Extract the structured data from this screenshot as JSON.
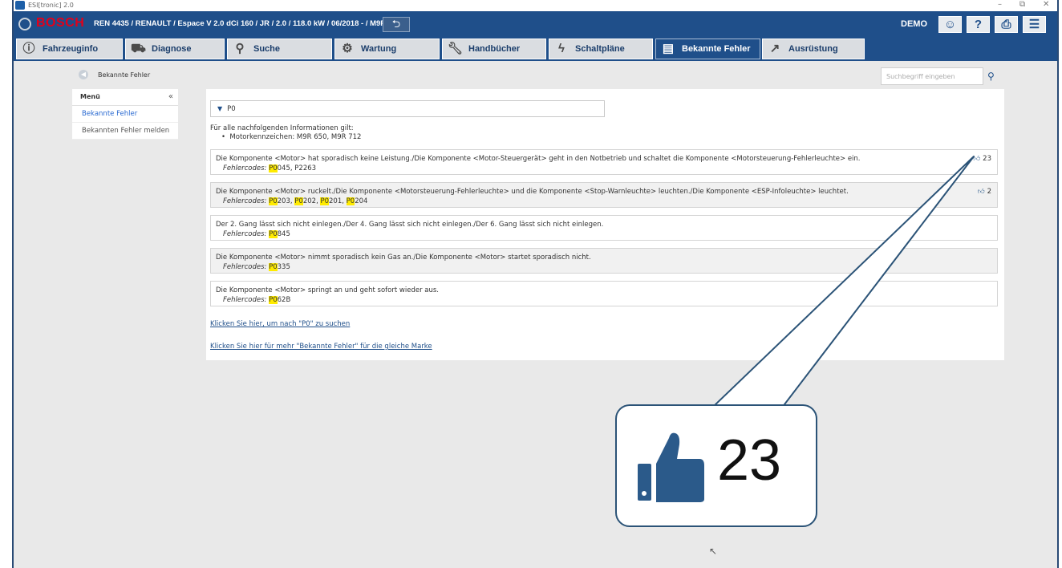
{
  "window": {
    "title": "ESI[tronic] 2.0",
    "controls": [
      "–",
      "⧉",
      "✕"
    ]
  },
  "header": {
    "brand": "BOSCH",
    "vehicle": "REN 4435 / RENAULT / Espace V 2.0 dCi 160 / JR / 2.0 / 118.0 kW / 06/2018 - / M9R...",
    "mode": "DEMO"
  },
  "tabs": [
    {
      "label": "Fahrzeuginfo",
      "icon": "info-icon"
    },
    {
      "label": "Diagnose",
      "icon": "car-icon"
    },
    {
      "label": "Suche",
      "icon": "search-icon"
    },
    {
      "label": "Wartung",
      "icon": "gears-icon"
    },
    {
      "label": "Handbücher",
      "icon": "wrench-icon"
    },
    {
      "label": "Schaltpläne",
      "icon": "lightning-icon"
    },
    {
      "label": "Bekannte Fehler",
      "icon": "book-icon",
      "active": true
    },
    {
      "label": "Ausrüstung",
      "icon": "external-link-icon"
    }
  ],
  "breadcrumb": {
    "label": "Bekannte Fehler"
  },
  "search": {
    "placeholder": "Suchbegriff eingeben"
  },
  "sidebar": {
    "title": "Menü",
    "items": [
      {
        "label": "Bekannte Fehler",
        "active": true
      },
      {
        "label": "Bekannten Fehler melden"
      }
    ]
  },
  "filter": {
    "value": "P0"
  },
  "intro": {
    "text": "Für alle nachfolgenden Informationen gilt:",
    "bullet": "Motorkennzeichen: M9R 650, M9R 712"
  },
  "codes_label": "Fehlercodes:",
  "faults": [
    {
      "description": "Die Komponente <Motor> hat sporadisch keine Leistung./Die Komponente <Motor-Steuergerät> geht in den Notbetrieb und schaltet die Komponente <Motorsteuerung-Fehlerleuchte> ein.",
      "codes": [
        {
          "hl": "P0",
          "rest": "045"
        },
        {
          "plain": "P2263"
        }
      ],
      "likes": "23"
    },
    {
      "description": "Die Komponente <Motor> ruckelt./Die Komponente <Motorsteuerung-Fehlerleuchte> und die Komponente <Stop-Warnleuchte> leuchten./Die Komponente <ESP-Infoleuchte> leuchtet.",
      "codes": [
        {
          "hl": "P0",
          "rest": "203"
        },
        {
          "hl": "P0",
          "rest": "202"
        },
        {
          "hl": "P0",
          "rest": "201"
        },
        {
          "hl": "P0",
          "rest": "204"
        }
      ],
      "likes": "2"
    },
    {
      "description": "Der 2. Gang lässt sich nicht einlegen./Der 4. Gang lässt sich nicht einlegen./Der 6. Gang lässt sich nicht einlegen.",
      "codes": [
        {
          "hl": "P0",
          "rest": "845"
        }
      ]
    },
    {
      "description": "Die Komponente <Motor> nimmt sporadisch kein Gas an./Die Komponente <Motor> startet sporadisch nicht.",
      "codes": [
        {
          "hl": "P0",
          "rest": "335"
        }
      ]
    },
    {
      "description": "Die Komponente <Motor> springt an und geht sofort wieder aus.",
      "codes": [
        {
          "hl": "P0",
          "rest": "62B"
        }
      ]
    }
  ],
  "links": {
    "search_p0": "Klicken Sie hier, um nach \"P0\" zu suchen",
    "more_faults": "Klicken Sie hier für mehr \"Bekannte Fehler\" für die gleiche Marke"
  },
  "callout": {
    "count": "23",
    "icon": "thumbs-up-icon"
  },
  "colors": {
    "header": "#1f4f8a",
    "highlight": "#ffeb00",
    "brand": "#e2001a"
  }
}
